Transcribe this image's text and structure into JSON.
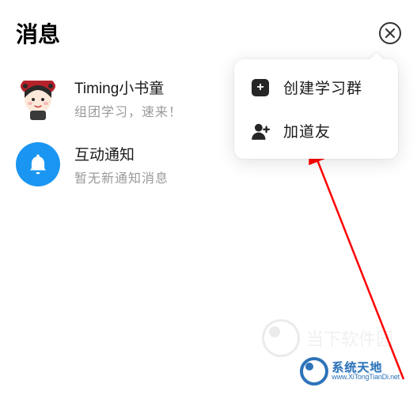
{
  "header": {
    "title": "消息"
  },
  "messages": [
    {
      "title": "Timing小书童",
      "subtitle": "组团学习，速来！"
    },
    {
      "title": "互动通知",
      "subtitle": "暂无新通知消息"
    }
  ],
  "popover": {
    "items": [
      {
        "label": "创建学习群"
      },
      {
        "label": "加道友"
      }
    ]
  },
  "watermark": {
    "faint_text": "当下软件园",
    "brand": "系统天地",
    "url": "www.XiTongTianDi.net"
  }
}
